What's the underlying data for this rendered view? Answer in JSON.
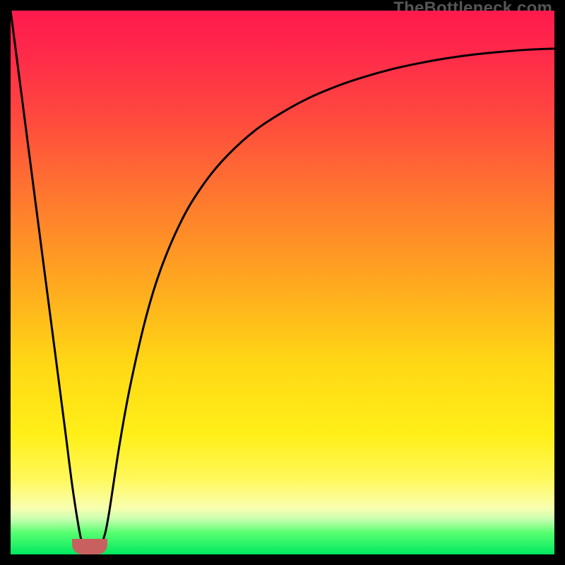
{
  "watermark": {
    "text": "TheBottleneck.com"
  },
  "colors": {
    "curve": "#000000",
    "marker": "#c86060",
    "frame_bg": "#000000"
  },
  "chart_data": {
    "type": "line",
    "title": "",
    "xlabel": "",
    "ylabel": "",
    "xlim": [
      0,
      100
    ],
    "ylim": [
      0,
      100
    ],
    "grid": false,
    "legend": false,
    "series": [
      {
        "name": "curve",
        "x": [
          0.0,
          2.0,
          4.0,
          6.0,
          8.0,
          10.0,
          11.5,
          13.0,
          14.0,
          15.0,
          16.0,
          17.0,
          18.0,
          20.0,
          22.0,
          25.0,
          28.0,
          32.0,
          36.0,
          40.0,
          45.0,
          50.0,
          55.0,
          60.0,
          65.0,
          70.0,
          75.0,
          80.0,
          85.0,
          90.0,
          95.0,
          100.0
        ],
        "y": [
          100.0,
          84.6,
          69.2,
          53.8,
          38.5,
          23.1,
          11.5,
          2.6,
          1.0,
          0.6,
          1.0,
          2.6,
          7.0,
          20.0,
          31.0,
          44.0,
          53.5,
          62.5,
          68.8,
          73.5,
          78.0,
          81.3,
          84.0,
          86.1,
          87.8,
          89.2,
          90.3,
          91.2,
          91.9,
          92.4,
          92.8,
          93.0
        ]
      }
    ],
    "marker": {
      "x_center": 14.5,
      "width_pct": 6.5
    }
  }
}
